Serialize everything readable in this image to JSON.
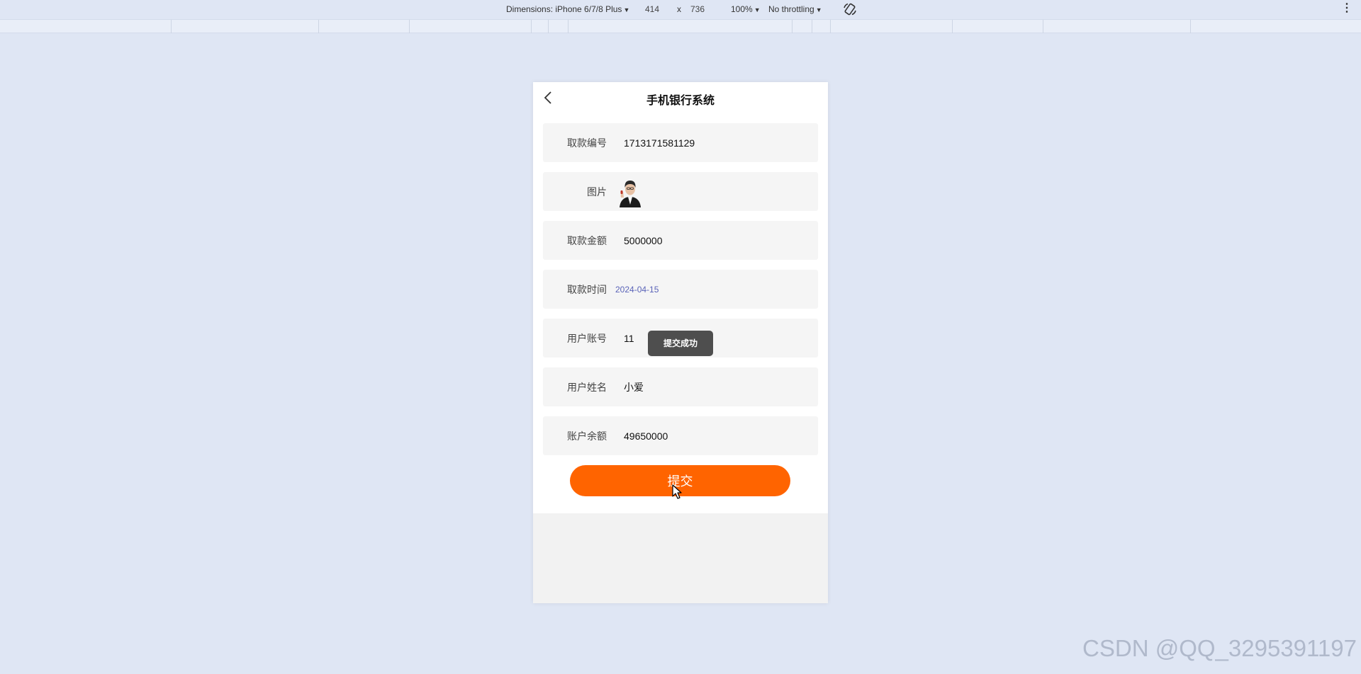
{
  "devtools": {
    "dimensions_label": "Dimensions: iPhone 6/7/8 Plus",
    "width": "414",
    "times": "x",
    "height": "736",
    "zoom": "100%",
    "throttling": "No throttling",
    "caret": "▼",
    "more_icon": "⋮"
  },
  "app": {
    "title": "手机银行系统",
    "fields": [
      {
        "label": "取款编号",
        "value": "1713171581129"
      },
      {
        "label": "图片",
        "image": "person-photo"
      },
      {
        "label": "取款金额",
        "value": "5000000"
      },
      {
        "label": "取款时间",
        "value": "2024-04-15"
      },
      {
        "label": "用户账号",
        "value": "11"
      },
      {
        "label": "用户姓名",
        "value": "小爱"
      },
      {
        "label": "账户余额",
        "value": "49650000"
      }
    ],
    "toast": "提交成功",
    "submit_label": "提交",
    "accent_color": "#ff6400"
  },
  "watermark": "CSDN @QQ_3295391197"
}
